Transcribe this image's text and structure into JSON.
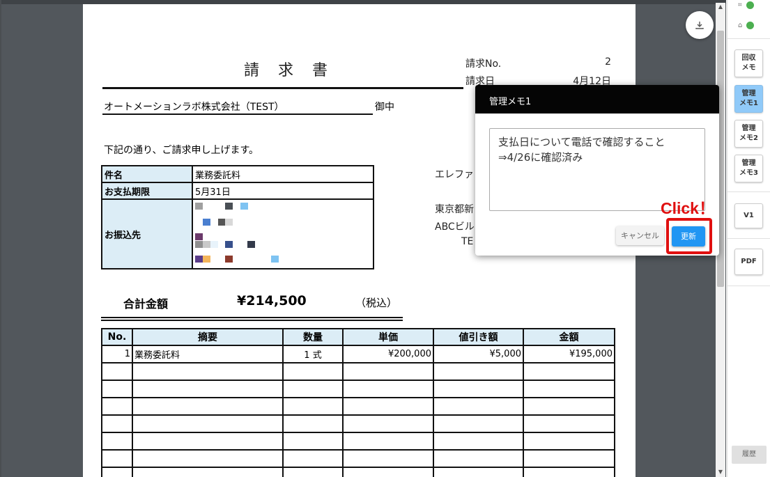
{
  "invoice": {
    "title": "請 求 書",
    "invoice_no_label": "請求No.",
    "invoice_no": "2",
    "invoice_date_label": "請求日",
    "invoice_date": "4月12日",
    "client": "オートメーションラボ株式会社（TEST）",
    "honorific": "御中",
    "intro": "下記の通り、ご請求申し上げます。",
    "subject_label": "件名",
    "subject": "業務委託料",
    "due_label": "お支払期限",
    "due": "5月31日",
    "bank_label": "お振込先",
    "sender_name": "エレファ",
    "sender_address1": "東京都新",
    "sender_address2": "ABCビル",
    "sender_tel": "TE",
    "total_label": "合計金額",
    "total": "¥214,500",
    "tax_note": "（税込）",
    "table_headers": [
      "No.",
      "摘要",
      "数量",
      "単価",
      "値引き額",
      "金額"
    ],
    "items": [
      {
        "no": "1",
        "desc": "業務委託料",
        "qty": "1 式",
        "unit_price": "¥200,000",
        "discount": "¥5,000",
        "amount": "¥195,000"
      }
    ]
  },
  "memo": {
    "title": "管理メモ1",
    "text": "支払日について電話で確認すること\n⇒4/26に確認済み",
    "cancel_label": "キャンセル",
    "update_label": "更新"
  },
  "annotation": {
    "click_label": "Click！",
    "color": "#e01010"
  },
  "sidebar": {
    "buttons": [
      {
        "label": "回収\nメモ",
        "active": false
      },
      {
        "label": "管理\nメモ1",
        "active": true
      },
      {
        "label": "管理\nメモ2",
        "active": false
      },
      {
        "label": "管理\nメモ3",
        "active": false
      },
      {
        "label": "V1",
        "active": false
      },
      {
        "label": "PDF",
        "active": false
      }
    ],
    "history_label": "履歴"
  },
  "colors": {
    "accent": "#2196f3",
    "active_tab": "#90caf9",
    "table_header_bg": "#dcedf6",
    "status_ok": "#4caf50"
  }
}
